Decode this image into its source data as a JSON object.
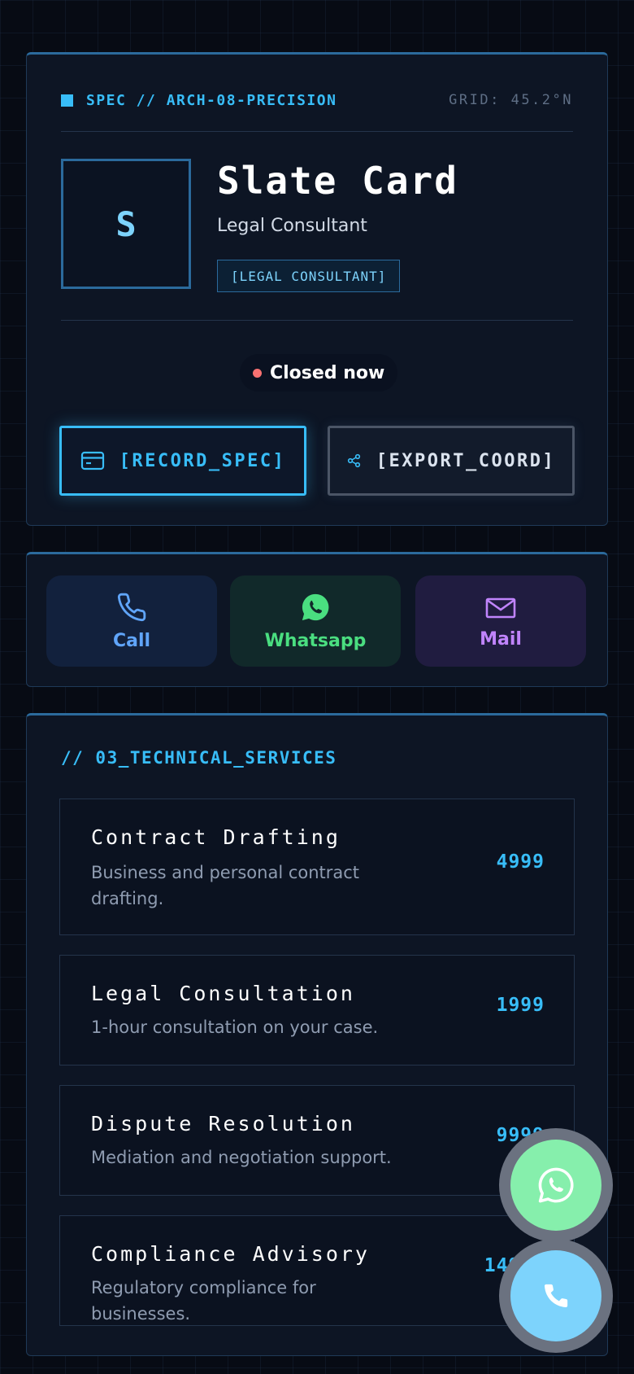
{
  "header": {
    "spec_label": "SPEC // ARCH-08-PRECISION",
    "grid_label": "GRID: 45.2°N"
  },
  "profile": {
    "avatar_initial": "S",
    "name": "Slate Card",
    "role": "Legal Consultant",
    "tag": "[LEGAL CONSULTANT]",
    "status": "Closed now",
    "status_color": "#f87171"
  },
  "actions": {
    "record_label": "[RECORD_SPEC]",
    "export_label": "[EXPORT_COORD]"
  },
  "contact": {
    "call_label": "Call",
    "whatsapp_label": "Whatsapp",
    "mail_label": "Mail"
  },
  "services": {
    "title": "// 03_TECHNICAL_SERVICES",
    "items": [
      {
        "title": "Contract Drafting",
        "desc": "Business and personal contract drafting.",
        "price": "4999"
      },
      {
        "title": "Legal Consultation",
        "desc": "1-hour consultation on your case.",
        "price": "1999"
      },
      {
        "title": "Dispute Resolution",
        "desc": "Mediation and negotiation support.",
        "price": "9999"
      },
      {
        "title": "Compliance Advisory",
        "desc": "Regulatory compliance for businesses.",
        "price": "14999"
      }
    ]
  },
  "colors": {
    "accent": "#38bdf8",
    "background": "#070b14",
    "card": "#0d1524",
    "whatsapp": "#4ade80",
    "mail": "#c084fc",
    "call": "#60a5fa"
  },
  "icons": {
    "record": "id-card-icon",
    "export": "share-icon",
    "call": "phone-icon",
    "whatsapp": "whatsapp-icon",
    "mail": "mail-icon"
  }
}
